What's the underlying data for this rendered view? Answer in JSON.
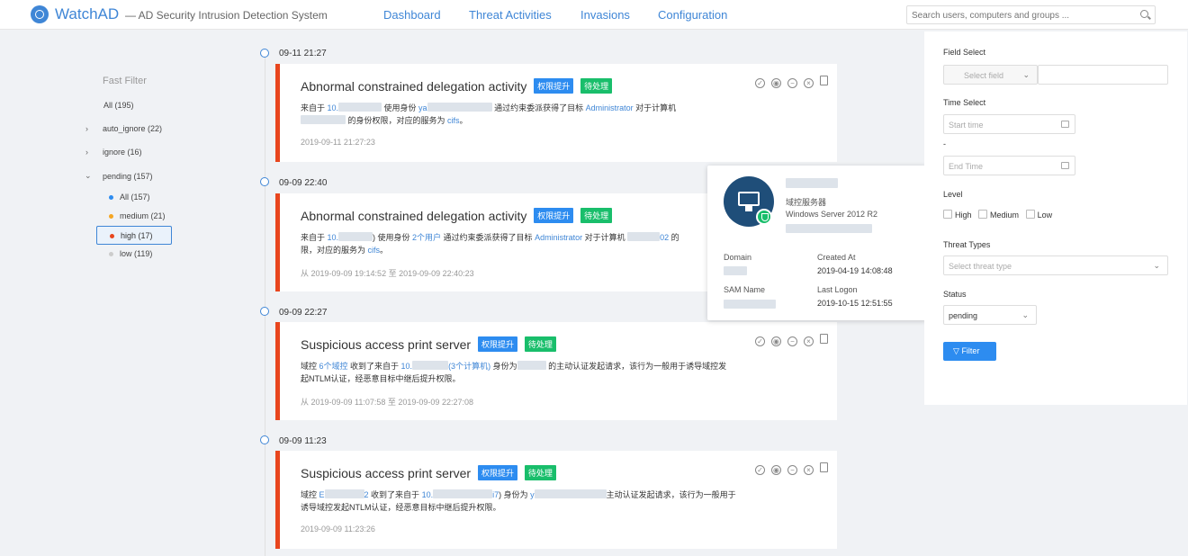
{
  "header": {
    "brand": "WatchAD",
    "subtitle": "— AD Security Intrusion Detection System",
    "nav": [
      "Dashboard",
      "Threat Activities",
      "Invasions",
      "Configuration"
    ],
    "search_placeholder": "Search users, computers and groups ..."
  },
  "fast_filter": {
    "title": "Fast Filter",
    "all": "All (195)",
    "auto_ignore": "auto_ignore (22)",
    "ignore": "ignore (16)",
    "pending": "pending (157)",
    "pending_children": [
      {
        "label": "All (157)",
        "color": "#2d8cf0"
      },
      {
        "label": "medium (21)",
        "color": "#f5a623"
      },
      {
        "label": "high (17)",
        "color": "#e8461e"
      },
      {
        "label": "low (119)",
        "color": "#cccccc"
      }
    ]
  },
  "timeline": {
    "dates": [
      "09-11 21:27",
      "09-09 22:40",
      "09-09 22:27",
      "09-09 11:23"
    ],
    "cards": [
      {
        "title": "Abnormal constrained delegation activity",
        "tags": [
          "权限提升",
          "待处理"
        ],
        "desc1_a": "来自于 ",
        "link1": "10.",
        "desc1_b": " 使用身份 ",
        "link2": "ya",
        "desc1_c": " 通过约束委派获得了目标 ",
        "link3": "Administrator",
        "desc1_d": " 对于计算机",
        "desc2_a": " 的身份权限，对应的服务为 ",
        "link4": "cifs",
        "desc2_b": "。",
        "time": "2019-09-11 21:27:23"
      },
      {
        "title": "Abnormal constrained delegation activity",
        "tags": [
          "权限提升",
          "待处理"
        ],
        "desc1_a": "来自于 ",
        "link1": "10.",
        "desc1_b": ") 使用身份 ",
        "link2": "2个用户",
        "desc1_c": " 通过约束委派获得了目标 ",
        "link3": "Administrator",
        "desc1_d": " 对于计算机 ",
        "link4": "02",
        "desc1_e": " 的",
        "desc2_a": "限，对应的服务为 ",
        "link5": "cifs",
        "desc2_b": "。",
        "time": "从 2019-09-09 19:14:52 至 2019-09-09 22:40:23"
      },
      {
        "title": "Suspicious access print server",
        "tags": [
          "权限提升",
          "待处理"
        ],
        "desc1_a": "域控 ",
        "link1": "6个域控",
        "desc1_b": " 收到了来自于 ",
        "link2": "10.",
        "link3": "(3个计算机)",
        "desc1_c": " 身份为",
        "desc1_d": " 的主动认证发起请求，该行为一般用于诱导域控发",
        "desc2": "起NTLM认证，经恶意目标中继后提升权限。",
        "time": "从 2019-09-09 11:07:58 至 2019-09-09 22:27:08"
      },
      {
        "title": "Suspicious access print server",
        "tags": [
          "权限提升",
          "待处理"
        ],
        "desc1_a": "域控 ",
        "link1": "E",
        "link1b": "2",
        "desc1_b": " 收到了来自于 ",
        "link2": "10.",
        "link3": "i7",
        "desc1_c": ") 身份为 ",
        "link4": "y",
        "desc1_d": "主动认证发起请求，该行为一般用于",
        "desc2": "诱导域控发起NTLM认证，经恶意目标中继后提升权限。",
        "time": "2019-09-09 11:23:26"
      }
    ]
  },
  "popover": {
    "role": "域控服务器",
    "os": "Windows Server 2012 R2",
    "domain_label": "Domain",
    "created_label": "Created At",
    "created_value": "2019-04-19 14:08:48",
    "sam_label": "SAM Name",
    "logon_label": "Last Logon",
    "logon_value": "2019-10-15 12:51:55"
  },
  "panel": {
    "field_select_label": "Field Select",
    "field_select_placeholder": "Select field",
    "time_select_label": "Time Select",
    "start_placeholder": "Start time",
    "dash": "-",
    "end_placeholder": "End Time",
    "level_label": "Level",
    "levels": [
      "High",
      "Medium",
      "Low"
    ],
    "threat_types_label": "Threat Types",
    "threat_types_placeholder": "Select threat type",
    "status_label": "Status",
    "status_value": "pending",
    "filter_button": "Filter"
  }
}
